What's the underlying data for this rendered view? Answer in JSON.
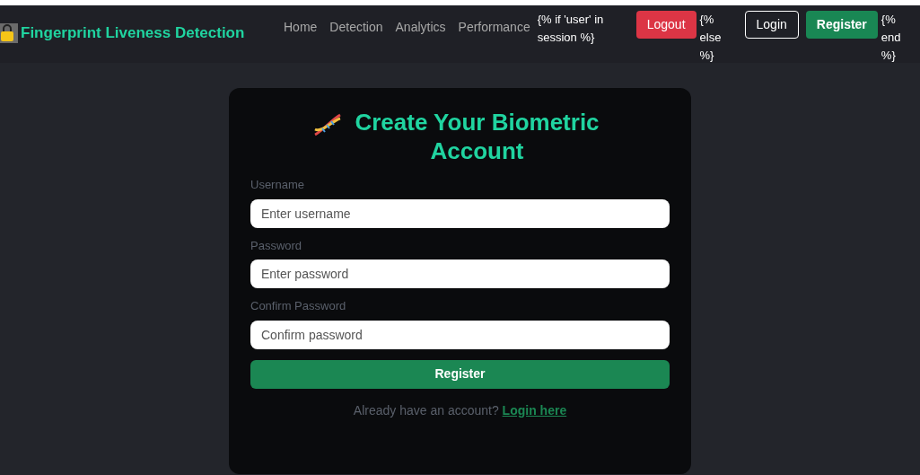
{
  "navbar": {
    "brand": "Fingerprint Liveness Detection",
    "links": [
      "Home",
      "Detection",
      "Analytics",
      "Performance"
    ],
    "template_if": "{% if 'user' in session %}",
    "logout_button": "Logout",
    "template_else": "{% else %}",
    "login_button": "Login",
    "register_button": "Register",
    "template_end": "{% end %}"
  },
  "form": {
    "title": "Create Your Biometric Account",
    "fields": [
      {
        "label": "Username",
        "placeholder": "Enter username"
      },
      {
        "label": "Password",
        "placeholder": "Enter password"
      },
      {
        "label": "Confirm Password",
        "placeholder": "Confirm password"
      }
    ],
    "submit": "Register",
    "footer_text": "Already have an account?",
    "footer_link": "Login here"
  }
}
